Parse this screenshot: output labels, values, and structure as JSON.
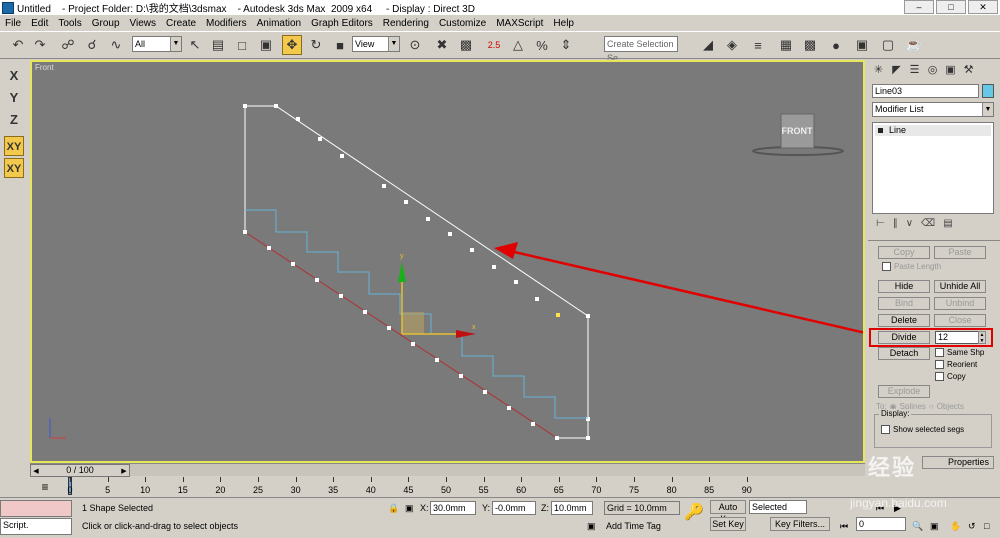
{
  "window": {
    "title": "Untitled    - Project Folder: D:\\我的文档\\3dsmax    - Autodesk 3ds Max  2009 x64     - Display : Direct 3D"
  },
  "menu": [
    "File",
    "Edit",
    "Tools",
    "Group",
    "Views",
    "Create",
    "Modifiers",
    "Animation",
    "Graph Editors",
    "Rendering",
    "Customize",
    "MAXScript",
    "Help"
  ],
  "toolbar": {
    "filter_value": "All",
    "refcoord_value": "View",
    "selection_set_placeholder": "Create Selection Se",
    "snap_label": "2.5"
  },
  "axis_constraints": [
    "X",
    "Y",
    "Z",
    "XY",
    "XY"
  ],
  "viewport": {
    "label": "Front",
    "viewcube_label": "FRONT",
    "gizmo_y": "y",
    "gizmo_x": "x"
  },
  "command_panel": {
    "object_name": "Line03",
    "modifier_list": "Modifier List",
    "stack_item": "Line",
    "buttons": {
      "copy": "Copy",
      "paste": "Paste",
      "paste_length": "Paste Length",
      "hide": "Hide",
      "unhide_all": "Unhide All",
      "bind": "Bind",
      "unbind": "Unbind",
      "delete": "Delete",
      "close": "Close",
      "divide": "Divide",
      "detach": "Detach",
      "explode": "Explode"
    },
    "divide_value": "12",
    "same_shp": "Same Shp",
    "reorient": "Reorient",
    "copy_check": "Copy",
    "to_label": "To:",
    "splines": "Splines",
    "objects": "Objects",
    "display_group": "Display:",
    "show_selected_segs": "Show selected segs",
    "properties_label": "Properties"
  },
  "timeline": {
    "frame": "0 / 100",
    "ticks": [
      "0",
      "5",
      "10",
      "15",
      "20",
      "25",
      "30",
      "35",
      "40",
      "45",
      "50",
      "55",
      "60",
      "65",
      "70",
      "75",
      "80",
      "85",
      "90"
    ]
  },
  "status": {
    "maxscript": "Script.",
    "selection": "1 Shape Selected",
    "prompt": "Click or click-and-drag to select objects",
    "x_label": "X:",
    "x_value": "30.0mm",
    "y_label": "Y:",
    "y_value": "-0.0mm",
    "z_label": "Z:",
    "z_value": "10.0mm",
    "grid": "Grid = 10.0mm",
    "auto_key": "Auto Key",
    "selected": "Selected",
    "set_key": "Set Key",
    "key_filters": "Key Filters...",
    "add_time_tag": "Add Time Tag",
    "frame_value": "0"
  },
  "watermark": {
    "big": "经验",
    "small": "jingyan.baidu.com"
  },
  "colors": {
    "viewport_bg": "#7a7a7a",
    "active_border": "#e6e65a",
    "annotation": "#e00000",
    "spline_white": "#ffffff",
    "spline_cyan": "#66b4d8",
    "spline_red": "#b03030"
  }
}
